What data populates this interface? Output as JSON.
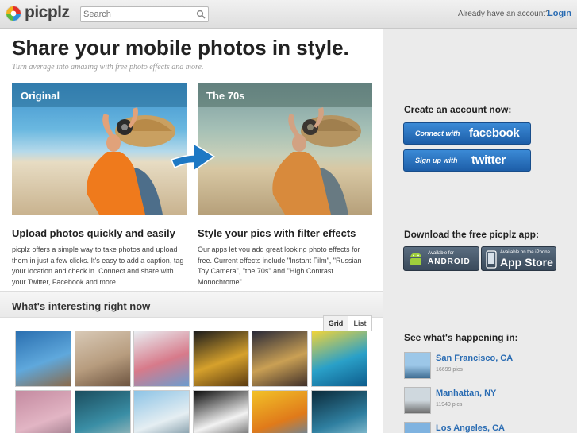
{
  "header": {
    "brand": "picplz",
    "search_placeholder": "Search",
    "account_prompt": "Already have an account?",
    "login_label": "Login"
  },
  "hero": {
    "title": "Share your mobile photos in style.",
    "tagline": "Turn average into amazing with free photo effects and more.",
    "photos": [
      {
        "label": "Original"
      },
      {
        "label": "The 70s"
      }
    ]
  },
  "features": [
    {
      "title": "Upload photos quickly and easily",
      "text": "picplz offers a simple way to take photos and upload them in just a few clicks. It's easy to add a caption, tag your location and check in. Connect and share with your Twitter, Facebook and more."
    },
    {
      "title": "Style your pics with filter effects",
      "text": "Our apps let you add great looking photo effects for free. Current effects include \"Instant Film\", \"Russian Toy Camera\", \"the 70s\" and \"High Contrast Monochrome\"."
    }
  ],
  "interesting": {
    "title": "What's interesting right now",
    "view_grid": "Grid",
    "view_list": "List",
    "thumbs": [
      {
        "colors": [
          "#2a6fb0",
          "#5fa8dc",
          "#8a6a4a"
        ]
      },
      {
        "colors": [
          "#d8c9b6",
          "#b79c7e",
          "#6d5440"
        ]
      },
      {
        "colors": [
          "#e9eef2",
          "#d77a8a",
          "#6b9ccf"
        ]
      },
      {
        "colors": [
          "#1c1c1c",
          "#d6a12c",
          "#5a3a10"
        ]
      },
      {
        "colors": [
          "#2a2a38",
          "#caa054",
          "#40302a"
        ]
      },
      {
        "colors": [
          "#f1d43a",
          "#2aa0c8",
          "#0d5c8c"
        ]
      },
      {
        "colors": [
          "#c48aa0",
          "#e2b5c4",
          "#8a6a7a"
        ]
      },
      {
        "colors": [
          "#1b4d5e",
          "#3a8ea5",
          "#b9c7c3"
        ]
      },
      {
        "colors": [
          "#8cc3e6",
          "#e5eef2",
          "#5a7a8a"
        ]
      },
      {
        "colors": [
          "#0a0a0a",
          "#f2f2f2",
          "#3a3a3a"
        ]
      },
      {
        "colors": [
          "#f2c228",
          "#e07a1a",
          "#3a8ad0"
        ]
      },
      {
        "colors": [
          "#0b2a3a",
          "#2f7fa0",
          "#a9d6e2"
        ]
      }
    ]
  },
  "sidebar": {
    "create_title": "Create an account now:",
    "facebook_small": "Connect with",
    "facebook_big": "facebook",
    "twitter_small": "Sign up with",
    "twitter_big": "twitter",
    "download_title": "Download the free picplz app:",
    "android_small": "Available for",
    "android_big": "ANDROID",
    "ios_small": "Available on the iPhone",
    "ios_big": "App Store",
    "happening_title": "See what's happening in:",
    "cities": [
      {
        "name": "San Francisco, CA",
        "count": "16699 pics",
        "colors": [
          "#9cc7e8",
          "#3f6d92"
        ]
      },
      {
        "name": "Manhattan, NY",
        "count": "11949 pics",
        "colors": [
          "#cfd8de",
          "#6c6c6c"
        ]
      },
      {
        "name": "Los Angeles, CA",
        "count": "",
        "colors": [
          "#7fb3e0",
          "#3d6a8f"
        ]
      }
    ]
  },
  "colors": {
    "link": "#2a6cb3",
    "button_blue": "#2b73c2"
  }
}
